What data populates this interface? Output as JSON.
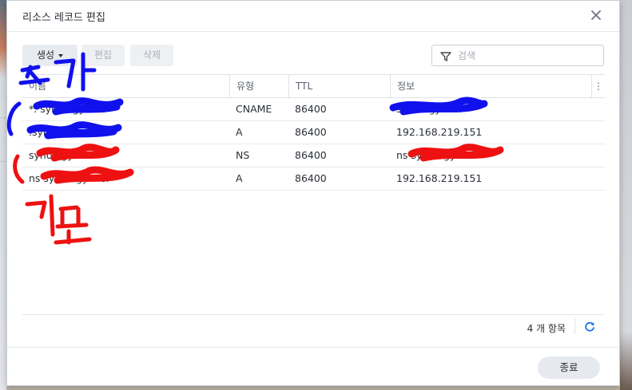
{
  "dialog": {
    "title": "리소스 레코드 편집"
  },
  "toolbar": {
    "create_label": "생성",
    "edit_label": "편집",
    "delete_label": "삭제",
    "search_placeholder": "검색"
  },
  "grid": {
    "columns": [
      "이름",
      "유형",
      "TTL",
      "정보"
    ],
    "more_glyph": "⋮",
    "rows": [
      {
        "name": "*.        synology.me.",
        "type": "CNAME",
        "ttl": "86400",
        "info": "                    synology.me."
      },
      {
        "name": "          .synology.me.",
        "type": "A",
        "ttl": "86400",
        "info": "192.168.219.151"
      },
      {
        "name": "          synology.me.",
        "type": "NS",
        "ttl": "86400",
        "info": "ns               synology.me."
      },
      {
        "name": "ns              synology.me.",
        "type": "A",
        "ttl": "86400",
        "info": "192.168.219.151"
      }
    ]
  },
  "footer": {
    "count_label": "4 개 항목"
  },
  "buttons": {
    "close_label": "종료"
  },
  "annotations": {
    "blue_label": "추가",
    "red_label": "기본"
  },
  "colors": {
    "accent": "#1a73e8",
    "blue_scribble": "#1111ee",
    "red_scribble": "#ee1111"
  },
  "icons": [
    "close-icon",
    "filter-icon",
    "refresh-icon",
    "caret-down-icon",
    "more-vertical-icon"
  ]
}
